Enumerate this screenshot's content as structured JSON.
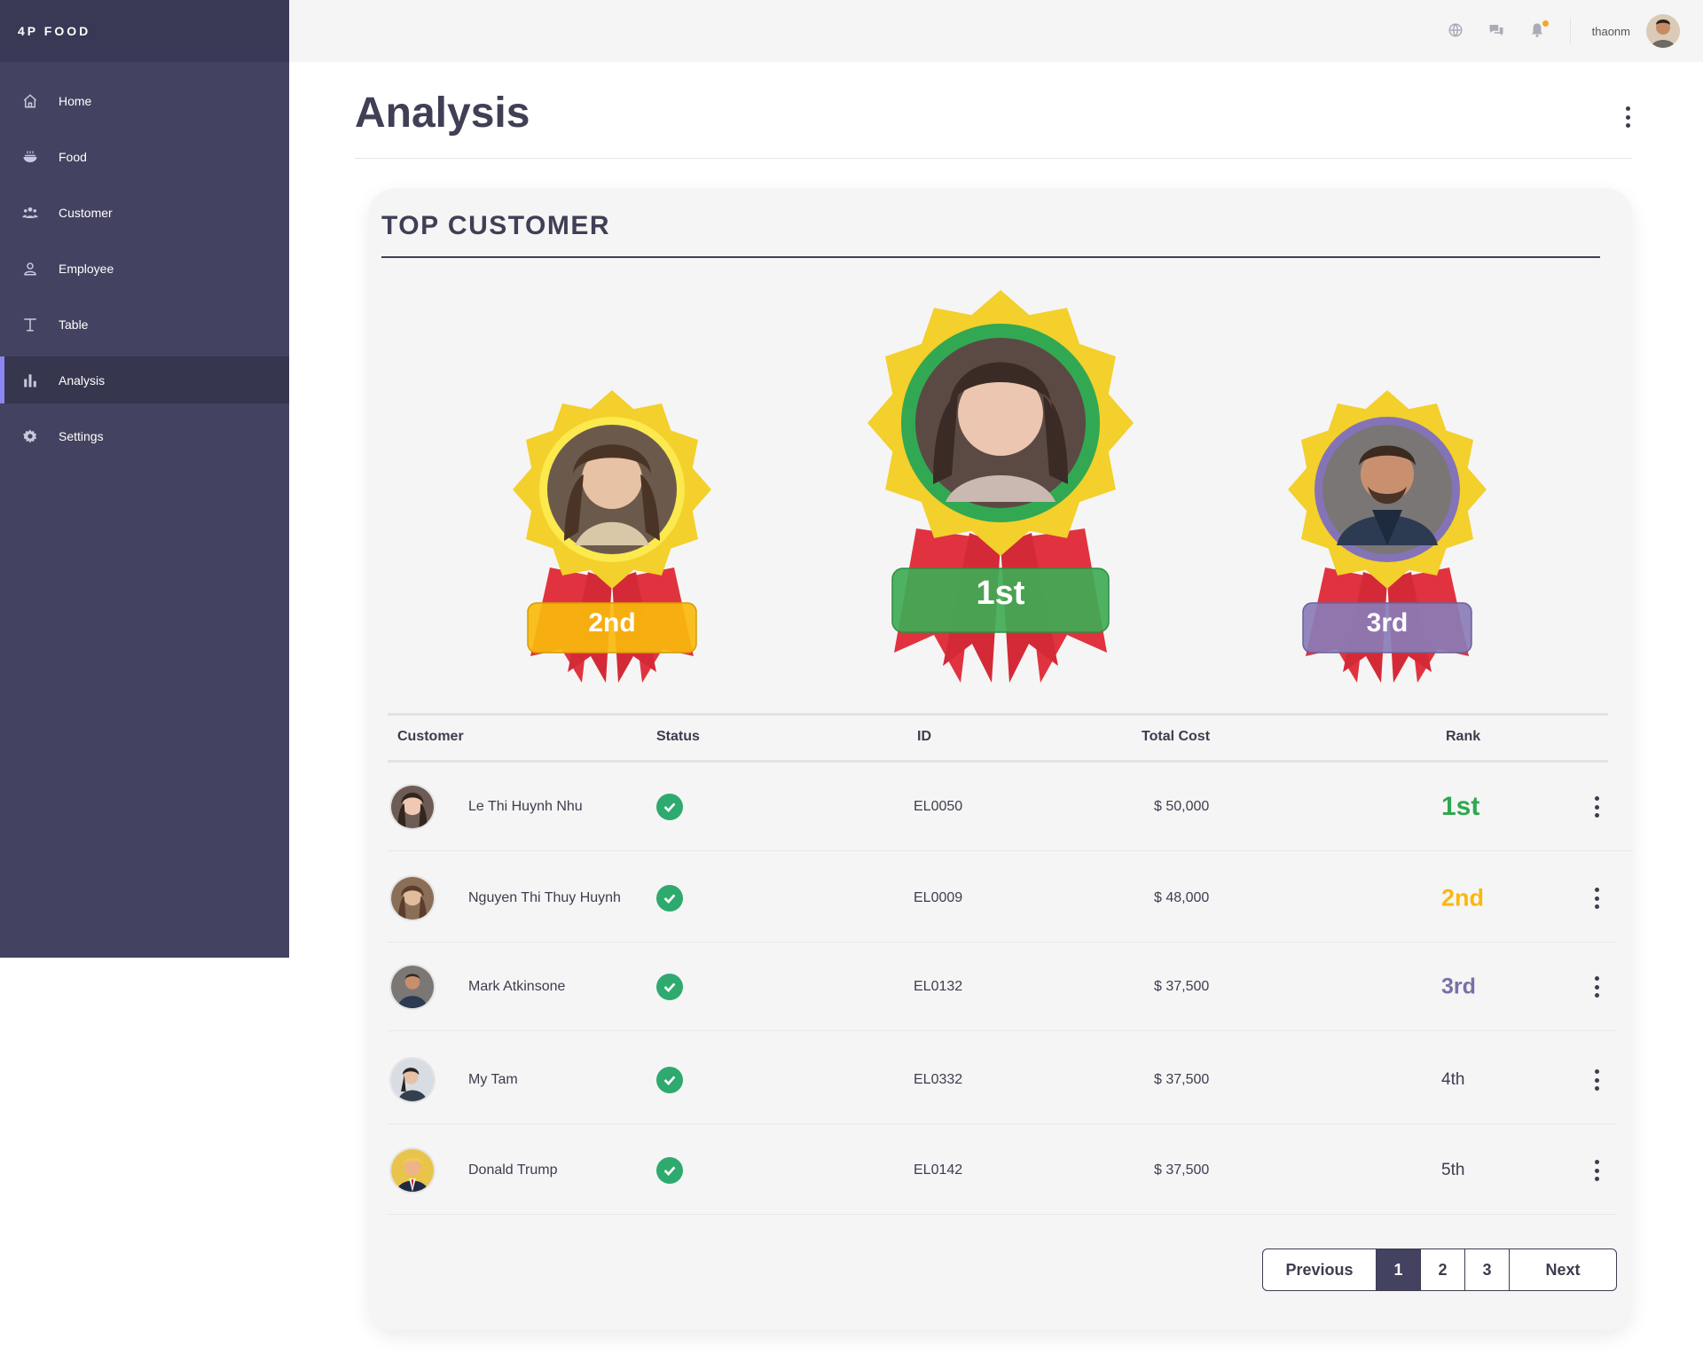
{
  "app": {
    "brand": "4P FOOD"
  },
  "sidebar": {
    "items": [
      {
        "label": "Home",
        "icon": "home-icon"
      },
      {
        "label": "Food",
        "icon": "food-bowl-icon"
      },
      {
        "label": "Customer",
        "icon": "users-icon"
      },
      {
        "label": "Employee",
        "icon": "user-icon"
      },
      {
        "label": "Table",
        "icon": "table-icon"
      },
      {
        "label": "Analysis",
        "icon": "bar-chart-icon",
        "active": true
      },
      {
        "label": "Settings",
        "icon": "gear-icon"
      }
    ]
  },
  "topbar": {
    "username": "thaonm",
    "icons": [
      "globe-icon",
      "chat-icon",
      "bell-icon"
    ]
  },
  "page": {
    "title": "Analysis"
  },
  "card": {
    "title": "TOP CUSTOMER"
  },
  "podium": [
    {
      "label": "2nd",
      "ring_color": "#fbe94e",
      "badge_color": "#f9b90d"
    },
    {
      "label": "1st",
      "ring_color": "#33a853",
      "badge_color": "#3fab55"
    },
    {
      "label": "3rd",
      "ring_color": "#8573b7",
      "badge_color": "#8a7cb7"
    }
  ],
  "table": {
    "headers": {
      "customer": "Customer",
      "status": "Status",
      "id": "ID",
      "total": "Total Cost",
      "rank": "Rank"
    },
    "rows": [
      {
        "name": "Le Thi Huynh Nhu",
        "id": "EL0050",
        "total": "$ 50,000",
        "rank": "1st"
      },
      {
        "name": "Nguyen Thi Thuy Huynh",
        "id": "EL0009",
        "total": "$ 48,000",
        "rank": "2nd"
      },
      {
        "name": "Mark Atkinsone",
        "id": "EL0132",
        "total": "$ 37,500",
        "rank": "3rd"
      },
      {
        "name": "My Tam",
        "id": "EL0332",
        "total": "$ 37,500",
        "rank": "4th"
      },
      {
        "name": "Donald Trump",
        "id": "EL0142",
        "total": "$ 37,500",
        "rank": "5th"
      }
    ]
  },
  "pagination": {
    "previous": "Previous",
    "pages": [
      "1",
      "2",
      "3"
    ],
    "current": "1",
    "next": "Next"
  },
  "colors": {
    "sidebar": "#434260",
    "gold": "#f3d02b",
    "ribbon": "#e0333f",
    "first": "#2fa84f",
    "second": "#f9b80d",
    "third": "#7b6fa8"
  }
}
